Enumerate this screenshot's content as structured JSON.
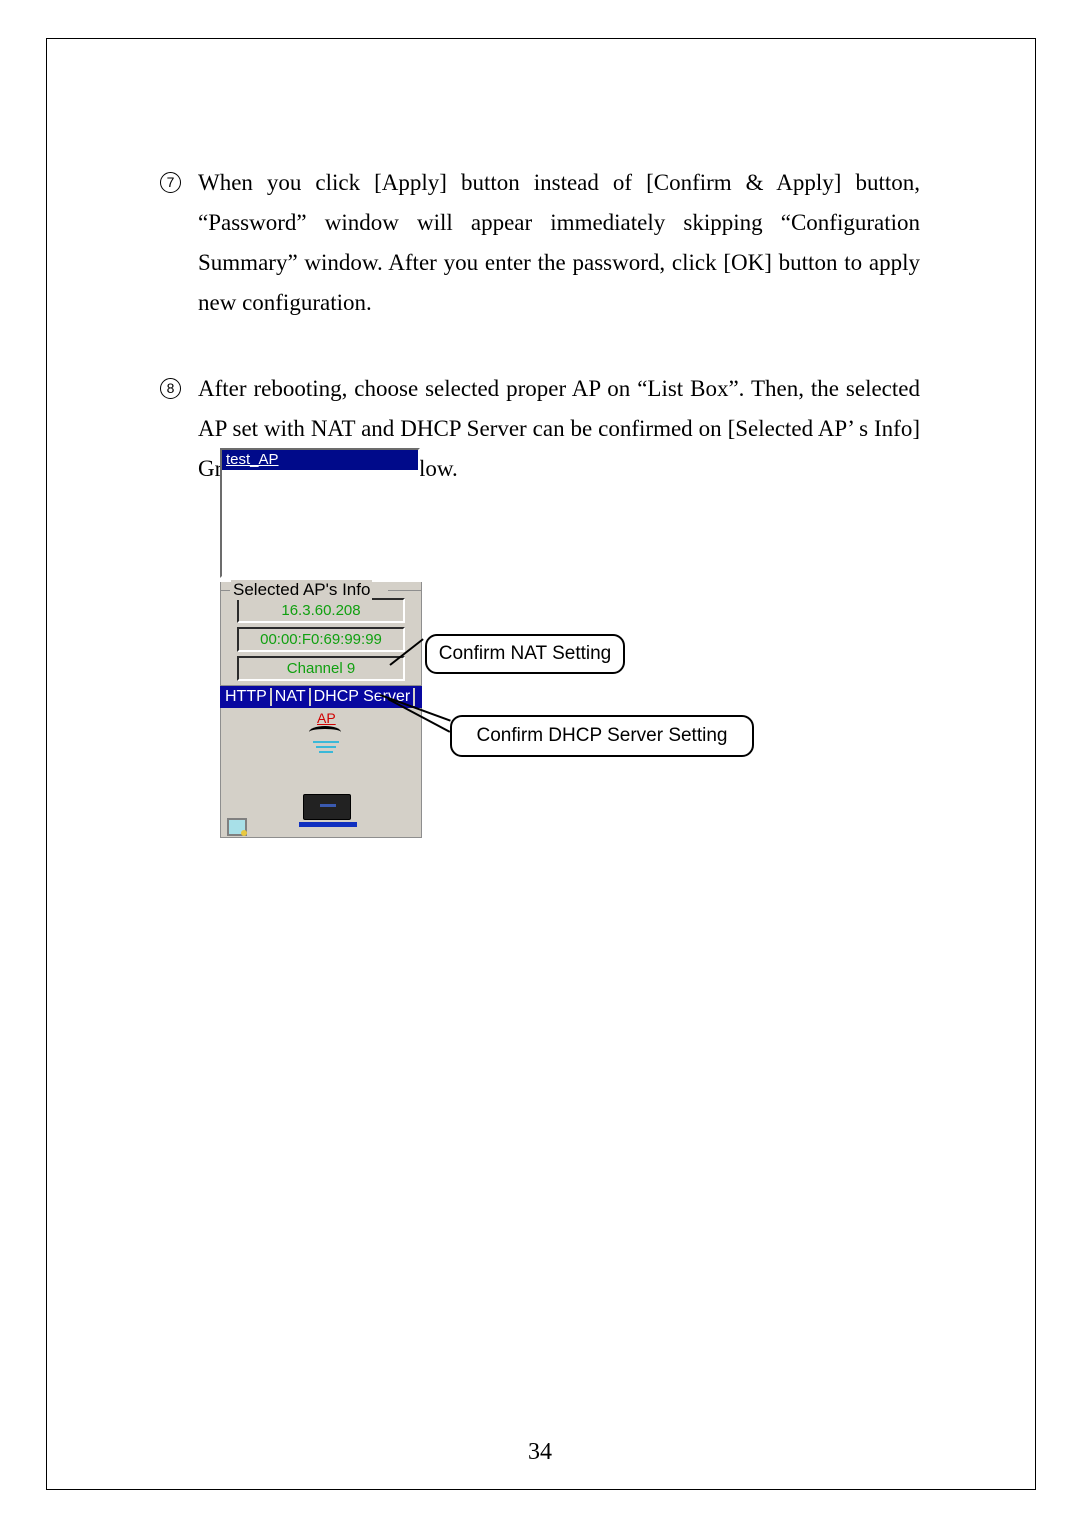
{
  "para7": {
    "marker": "7",
    "text": "When you click [Apply] button instead of [Confirm & Apply] button, “Password” window will appear immediately skipping “Configuration Summary” window. After you enter the password, click [OK] button to apply new configuration."
  },
  "para8": {
    "marker": "8",
    "text": "After rebooting, choose selected proper AP on “List Box”. Then, the selected AP set with NAT and DHCP Server can be confirmed on [Selected AP’ s Info] Group Box as shown below."
  },
  "figure": {
    "listbox_item": "test_AP",
    "group_title": "Selected AP's Info",
    "ip": "16.3.60.208",
    "mac": "00:00:F0:69:99:99",
    "channel": "Channel 9",
    "tags": {
      "http": "HTTP",
      "nat": "NAT",
      "dhcp": "DHCP Server"
    },
    "ap_label": "AP"
  },
  "callouts": {
    "nat": "Confirm NAT Setting",
    "dhcp": "Confirm DHCP Server Setting"
  },
  "page_number": "34"
}
